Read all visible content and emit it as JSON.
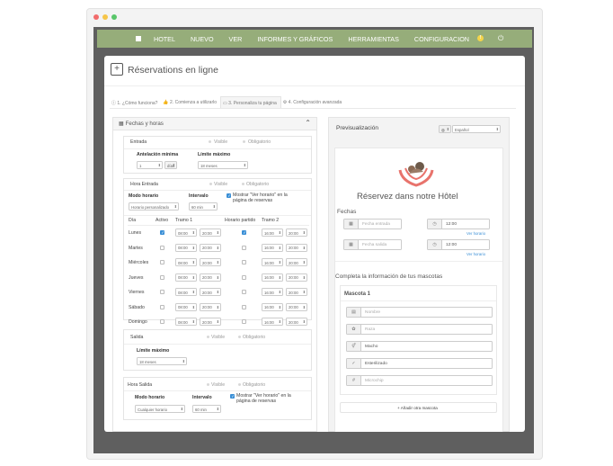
{
  "navbar": {
    "items": [
      "HOTEL",
      "NUEVO",
      "VER",
      "INFORMES Y GRÁFICOS",
      "HERRAMIENTAS",
      "CONFIGURACION"
    ]
  },
  "page": {
    "title": "Réservations en ligne"
  },
  "tabs": [
    "1. ¿Cómo funciona?",
    "2. Comienza a utilizarlo",
    "3. Personaliza tu página",
    "4. Configuración avanzada"
  ],
  "left": {
    "section_title": "Fechas y horas",
    "entrada": {
      "title": "Entrada",
      "visible": "Visible",
      "obligatorio": "Obligatorio",
      "antelacion_label": "Antelación mínima",
      "antelacion_value": "1",
      "antelacion_unit": "días",
      "limite_label": "Límite máximo",
      "limite_value": "18 meses"
    },
    "hora_entrada": {
      "title": "Hora Entrada",
      "visible": "Visible",
      "obligatorio": "Obligatorio",
      "modo_label": "Modo horario",
      "modo_value": "Horario personalizado",
      "intervalo_label": "Intervalo",
      "intervalo_value": "60 min",
      "mostrar_label": "Mostrar \"Ver horario\" en la página de reservas",
      "headers": [
        "Día",
        "Activo",
        "Tramo 1",
        "Horario partido",
        "Tramo 2"
      ],
      "rows": [
        {
          "day": "Lunes",
          "active": true,
          "t1a": "08:00",
          "t1b": "20:00",
          "split": true,
          "t2a": "16:00",
          "t2b": "20:00"
        },
        {
          "day": "Martes",
          "active": false,
          "t1a": "08:00",
          "t1b": "20:00",
          "split": false,
          "t2a": "16:00",
          "t2b": "20:00"
        },
        {
          "day": "Miércoles",
          "active": false,
          "t1a": "08:00",
          "t1b": "20:00",
          "split": false,
          "t2a": "16:00",
          "t2b": "20:00"
        },
        {
          "day": "Jueves",
          "active": false,
          "t1a": "08:00",
          "t1b": "20:00",
          "split": false,
          "t2a": "16:00",
          "t2b": "20:00"
        },
        {
          "day": "Viernes",
          "active": false,
          "t1a": "08:00",
          "t1b": "20:00",
          "split": false,
          "t2a": "16:00",
          "t2b": "20:00"
        },
        {
          "day": "Sábado",
          "active": false,
          "t1a": "08:00",
          "t1b": "20:00",
          "split": false,
          "t2a": "16:00",
          "t2b": "20:00"
        },
        {
          "day": "Domingo",
          "active": false,
          "t1a": "08:00",
          "t1b": "20:00",
          "split": false,
          "t2a": "16:00",
          "t2b": "20:00"
        }
      ]
    },
    "salida": {
      "title": "Salida",
      "visible": "Visible",
      "obligatorio": "Obligatorio",
      "limite_label": "Límite máximo",
      "limite_value": "18 meses"
    },
    "hora_salida": {
      "title": "Hora Salida",
      "visible": "Visible",
      "obligatorio": "Obligatorio",
      "modo_label": "Modo horario",
      "modo_value": "Cualquier horario",
      "intervalo_label": "Intervalo",
      "intervalo_value": "60 min",
      "mostrar_label": "Mostrar \"Ver horario\" en la página de reservas"
    }
  },
  "right": {
    "title": "Previsualización",
    "language": "Español",
    "hotel_title": "Réservez dans notre Hôtel",
    "fechas_label": "Fechas",
    "fecha_entrada": "Fecha entrada",
    "fecha_salida": "Fecha salida",
    "hora1": "12:00",
    "hora2": "12:00",
    "ver_horario": "Ver horario",
    "mascotas_title": "Completa la información de tus mascotas",
    "mascota_title": "Mascota 1",
    "nombre": "Nombre",
    "raza": "Raza",
    "sexo": "Macho",
    "esterilizado": "Esterilizado",
    "microchip": "Microchip",
    "add_pet": "+ Añadir otra mascota"
  },
  "colors": {
    "navbar": "#96ad7a",
    "accent": "#3a8fd6",
    "logo": "#e8736c"
  }
}
